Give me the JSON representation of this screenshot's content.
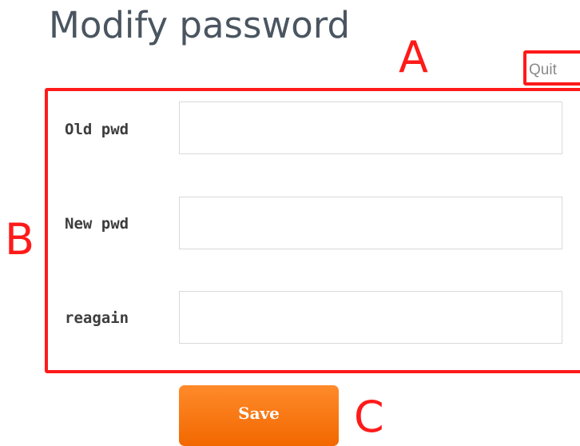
{
  "header": {
    "title": "Modify password",
    "quit_label": "Quit"
  },
  "form": {
    "fields": [
      {
        "label": "Old pwd",
        "value": "",
        "placeholder": ""
      },
      {
        "label": "New pwd",
        "value": "",
        "placeholder": ""
      },
      {
        "label": "reagain",
        "value": "",
        "placeholder": ""
      }
    ],
    "save_label": "Save"
  },
  "annotations": {
    "a": "A",
    "b": "B",
    "c": "C",
    "color": "#ff1a1a"
  },
  "colors": {
    "button": "#f26800",
    "title_text": "#4a5560",
    "input_border": "#d9d9d9"
  }
}
